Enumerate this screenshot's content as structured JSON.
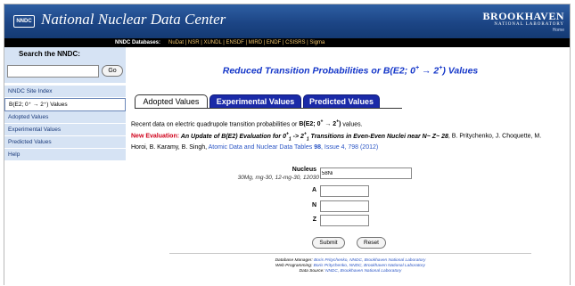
{
  "header": {
    "logo_text": "NNDC",
    "site_title": "National Nuclear Data Center",
    "bnl_name": "BROOKHAVEN",
    "bnl_sub": "NATIONAL LABORATORY",
    "bnl_home": "Home"
  },
  "db_bar": {
    "label": "NNDC Databases:",
    "links": "NuDat | NSR | XUNDL | ENSDF | MIRD | ENDF | CSISRS | Sigma"
  },
  "sidebar": {
    "search_title": "Search the NNDC:",
    "search_value": "",
    "go_label": "Go",
    "items": [
      "NNDC Site Index",
      "B(E2; 0⁺ → 2⁺) Values",
      "Adopted Values",
      "Experimental Values",
      "Predicted Values",
      "Help"
    ]
  },
  "main": {
    "title_prefix": "Reduced Transition Probabilities or B(E2; 0",
    "title_sup1": "+",
    "title_arrow": " → 2",
    "title_sup2": "+",
    "title_suffix": ") Values",
    "tabs": [
      "Adopted Values",
      "Experimental Values",
      "Predicted Values"
    ],
    "desc_text": "Recent data on electric quadrupole transition probabilities or ",
    "desc_bold": "B(E2; 0",
    "desc_bold_sup1": "+",
    "desc_bold_arrow": " → 2",
    "desc_bold_sup2": "+",
    "desc_bold_end": ")",
    "desc_end": " values.",
    "new_eval_label": "New Evaluation:",
    "paper_title_a": " An Update of B(E2) Evaluation for 0",
    "paper_sup1": "+",
    "paper_sub1": "1",
    "paper_title_b": " -> 2",
    "paper_sup2": "+",
    "paper_sub2": "1",
    "paper_title_c": " Transitions in Even-Even Nuclei near N~ Z~ 28",
    "authors": ", B. Pritychenko, J. Choquette, M. Horoi, B. Karamy, B. Singh, ",
    "journal_link": "Atomic Data and Nuclear Data Tables",
    "journal_vol": "98",
    "journal_rest": ", Issue 4, 798 (2012)"
  },
  "form": {
    "nucleus_label": "Nucleus",
    "nucleus_value": "58Ni",
    "nucleus_hint": "30Mg, mg-30, 12-mg-30, 12030",
    "a_label": "A",
    "n_label": "N",
    "z_label": "Z",
    "a_value": "",
    "n_value": "",
    "z_value": "",
    "submit_label": "Submit",
    "reset_label": "Reset"
  },
  "footer": {
    "manager_label": "Database Manager:",
    "manager": "Boris Pritychenko, NNDC, Brookhaven National Laboratory",
    "programming_label": "Web Programming:",
    "programming": "Boris Pritychenko, NNDC, Brookhaven National Laboratory",
    "source_label": "Data Source:",
    "source": "NNDC, Brookhaven National Laboratory"
  }
}
